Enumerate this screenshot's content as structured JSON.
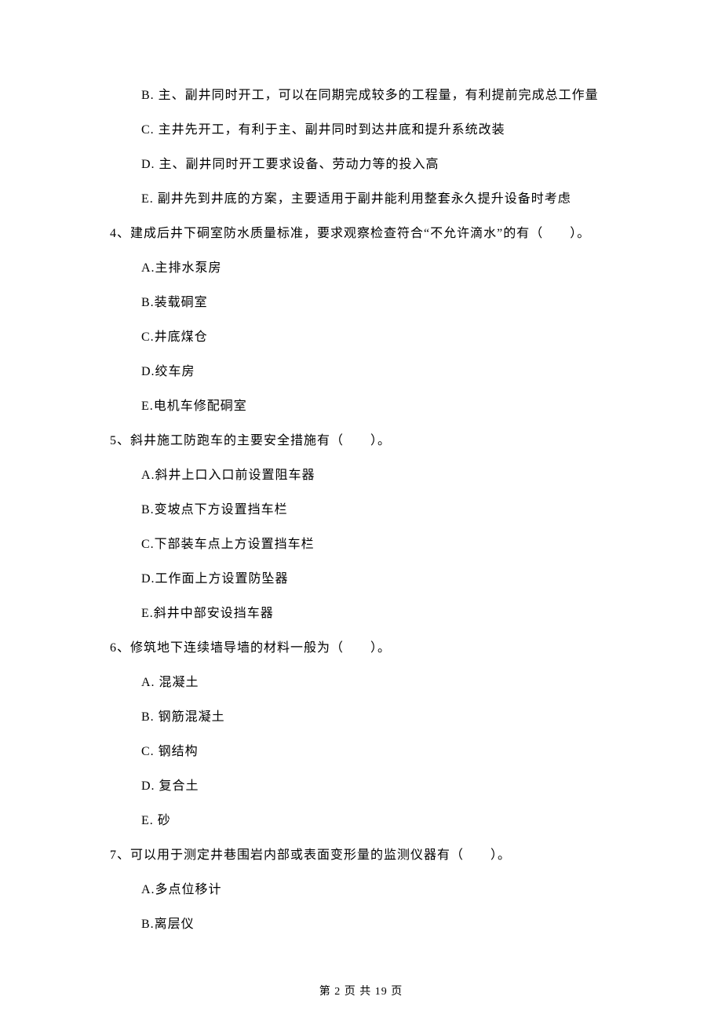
{
  "q3_options": {
    "B": "B.  主、副井同时开工，可以在同期完成较多的工程量，有利提前完成总工作量",
    "C": "C.  主井先开工，有利于主、副井同时到达井底和提升系统改装",
    "D": "D.  主、副井同时开工要求设备、劳动力等的投入高",
    "E": "E.  副井先到井底的方案，主要适用于副井能利用整套永久提升设备时考虑"
  },
  "q4": {
    "stem": "4、建成后井下硐室防水质量标准，要求观察检查符合“不允许滴水”的有（　　）。",
    "A": "A.主排水泵房",
    "B": "B.装载硐室",
    "C": "C.井底煤仓",
    "D": "D.绞车房",
    "E": "E.电机车修配硐室"
  },
  "q5": {
    "stem": "5、斜井施工防跑车的主要安全措施有（　　）。",
    "A": "A.斜井上口入口前设置阻车器",
    "B": "B.变坡点下方设置挡车栏",
    "C": "C.下部装车点上方设置挡车栏",
    "D": "D.工作面上方设置防坠器",
    "E": "E.斜井中部安设挡车器"
  },
  "q6": {
    "stem": "6、修筑地下连续墙导墙的材料一般为（　　）。",
    "A": "A.  混凝土",
    "B": "B.  钢筋混凝土",
    "C": "C.  钢结构",
    "D": "D.  复合土",
    "E": "E.  砂"
  },
  "q7": {
    "stem": "7、可以用于测定井巷围岩内部或表面变形量的监测仪器有（　　）。",
    "A": "A.多点位移计",
    "B": "B.离层仪"
  },
  "footer": "第 2 页 共 19 页"
}
